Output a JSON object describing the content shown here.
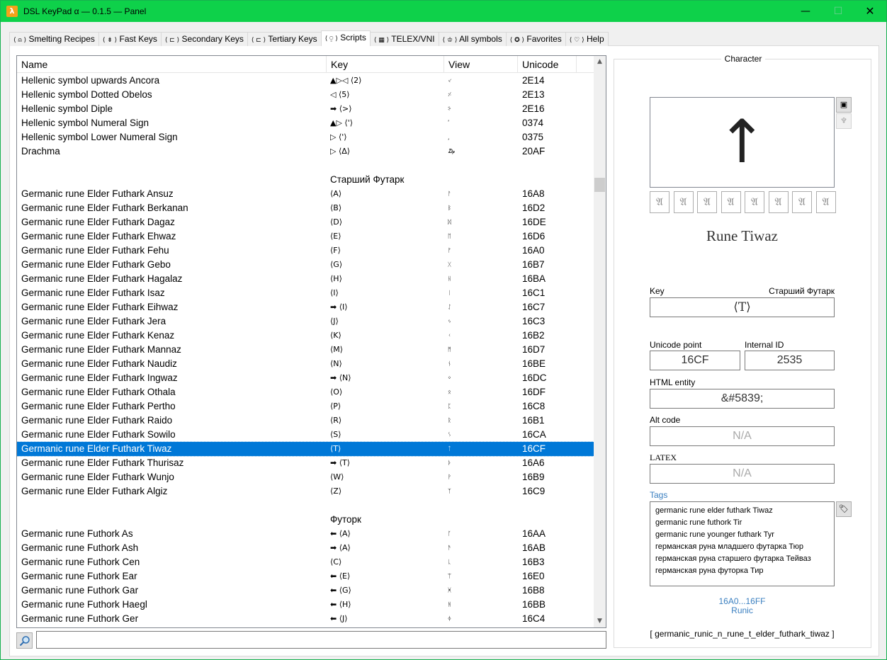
{
  "window": {
    "app_icon": "λ",
    "title": "DSL KeyPad α — 0.1.5 — Panel",
    "min_glyph": "—",
    "max_glyph": "☐",
    "close_glyph": "✕"
  },
  "tabs": [
    {
      "icon": "⟨ ⍝ ⟩",
      "label": "Smelting Recipes"
    },
    {
      "icon": "⟨ ⇟ ⟩",
      "label": "Fast Keys"
    },
    {
      "icon": "⟨ ⊏ ⟩",
      "label": "Secondary Keys"
    },
    {
      "icon": "⟨ ⊏ ⟩",
      "label": "Tertiary Keys"
    },
    {
      "icon": "⟨ ⍜ ⟩",
      "label": "Scripts"
    },
    {
      "icon": "⟨ ▦ ⟩",
      "label": "TELEX/VNI"
    },
    {
      "icon": "⟨ ♔ ⟩",
      "label": "All symbols"
    },
    {
      "icon": "⟨ ✪ ⟩",
      "label": "Favorites"
    },
    {
      "icon": "⟨ ♡ ⟩",
      "label": "Help"
    }
  ],
  "active_tab": 4,
  "list": {
    "columns": {
      "name": "Name",
      "key": "Key",
      "view": "View",
      "unicode": "Unicode"
    },
    "rows": [
      {
        "name": "Hellenic symbol upwards Ancora",
        "key": "▲▷◁ ⟨2⟩",
        "view": "⸔",
        "unicode": "2E14"
      },
      {
        "name": "Hellenic symbol Dotted Obelos",
        "key": "◁ ⟨5⟩",
        "view": "⸓",
        "unicode": "2E13"
      },
      {
        "name": "Hellenic symbol Diple",
        "key": "➡ ⟨>⟩",
        "view": "⸖",
        "unicode": "2E16"
      },
      {
        "name": "Hellenic symbol Numeral Sign",
        "key": "▲▷ ⟨'⟩",
        "view": "ʹ",
        "unicode": "0374"
      },
      {
        "name": "Hellenic symbol Lower Numeral Sign",
        "key": "▷ ⟨'⟩",
        "view": "͵",
        "unicode": "0375"
      },
      {
        "name": "Drachma",
        "key": "▷ ⟨Δ⟩",
        "view": "₯",
        "unicode": "20AF"
      },
      {
        "name": "",
        "key": "",
        "view": "",
        "unicode": "",
        "blank": true
      },
      {
        "name": "",
        "key": "Старший Футарк",
        "view": "",
        "unicode": "",
        "group": true
      },
      {
        "name": "Germanic rune Elder Futhark Ansuz",
        "key": "⟨A⟩",
        "view": "ᚨ",
        "unicode": "16A8"
      },
      {
        "name": "Germanic rune Elder Futhark Berkanan",
        "key": "⟨B⟩",
        "view": "ᛒ",
        "unicode": "16D2"
      },
      {
        "name": "Germanic rune Elder Futhark Dagaz",
        "key": "⟨D⟩",
        "view": "ᛞ",
        "unicode": "16DE"
      },
      {
        "name": "Germanic rune Elder Futhark Ehwaz",
        "key": "⟨E⟩",
        "view": "ᛖ",
        "unicode": "16D6"
      },
      {
        "name": "Germanic rune Elder Futhark Fehu",
        "key": "⟨F⟩",
        "view": "ᚠ",
        "unicode": "16A0"
      },
      {
        "name": "Germanic rune Elder Futhark Gebo",
        "key": "⟨G⟩",
        "view": "ᚷ",
        "unicode": "16B7"
      },
      {
        "name": "Germanic rune Elder Futhark Hagalaz",
        "key": "⟨H⟩",
        "view": "ᚺ",
        "unicode": "16BA"
      },
      {
        "name": "Germanic rune Elder Futhark Isaz",
        "key": "⟨I⟩",
        "view": "ᛁ",
        "unicode": "16C1"
      },
      {
        "name": "Germanic rune Elder Futhark Eihwaz",
        "key": "➡ ⟨I⟩",
        "view": "ᛇ",
        "unicode": "16C7"
      },
      {
        "name": "Germanic rune Elder Futhark Jera",
        "key": "⟨J⟩",
        "view": "ᛃ",
        "unicode": "16C3"
      },
      {
        "name": "Germanic rune Elder Futhark Kenaz",
        "key": "⟨K⟩",
        "view": "ᚲ",
        "unicode": "16B2"
      },
      {
        "name": "Germanic rune Elder Futhark Mannaz",
        "key": "⟨M⟩",
        "view": "ᛗ",
        "unicode": "16D7"
      },
      {
        "name": "Germanic rune Elder Futhark Naudiz",
        "key": "⟨N⟩",
        "view": "ᚾ",
        "unicode": "16BE"
      },
      {
        "name": "Germanic rune Elder Futhark Ingwaz",
        "key": "➡ ⟨N⟩",
        "view": "ᛜ",
        "unicode": "16DC"
      },
      {
        "name": "Germanic rune Elder Futhark Othala",
        "key": "⟨O⟩",
        "view": "ᛟ",
        "unicode": "16DF"
      },
      {
        "name": "Germanic rune Elder Futhark Pertho",
        "key": "⟨P⟩",
        "view": "ᛈ",
        "unicode": "16C8"
      },
      {
        "name": "Germanic rune Elder Futhark Raido",
        "key": "⟨R⟩",
        "view": "ᚱ",
        "unicode": "16B1"
      },
      {
        "name": "Germanic rune Elder Futhark Sowilo",
        "key": "⟨S⟩",
        "view": "ᛊ",
        "unicode": "16CA"
      },
      {
        "name": "Germanic rune Elder Futhark Tiwaz",
        "key": "⟨T⟩",
        "view": "ᛏ",
        "unicode": "16CF",
        "selected": true
      },
      {
        "name": "Germanic rune Elder Futhark Thurisaz",
        "key": "➡ ⟨T⟩",
        "view": "ᚦ",
        "unicode": "16A6"
      },
      {
        "name": "Germanic rune Elder Futhark Wunjo",
        "key": "⟨W⟩",
        "view": "ᚹ",
        "unicode": "16B9"
      },
      {
        "name": "Germanic rune Elder Futhark Algiz",
        "key": "⟨Z⟩",
        "view": "ᛉ",
        "unicode": "16C9"
      },
      {
        "name": "",
        "key": "",
        "view": "",
        "unicode": "",
        "blank": true
      },
      {
        "name": "",
        "key": "Футорк",
        "view": "",
        "unicode": "",
        "group": true
      },
      {
        "name": "Germanic rune Futhork As",
        "key": "⬅ ⟨A⟩",
        "view": "ᚪ",
        "unicode": "16AA"
      },
      {
        "name": "Germanic rune Futhork Ash",
        "key": "➡ ⟨A⟩",
        "view": "ᚫ",
        "unicode": "16AB"
      },
      {
        "name": "Germanic rune Futhork Cen",
        "key": "⟨C⟩",
        "view": "ᚳ",
        "unicode": "16B3"
      },
      {
        "name": "Germanic rune Futhork Ear",
        "key": "⬅ ⟨E⟩",
        "view": "ᛠ",
        "unicode": "16E0"
      },
      {
        "name": "Germanic rune Futhork Gar",
        "key": "⬅ ⟨G⟩",
        "view": "ᚸ",
        "unicode": "16B8"
      },
      {
        "name": "Germanic rune Futhork Haegl",
        "key": "⬅ ⟨H⟩",
        "view": "ᚻ",
        "unicode": "16BB"
      },
      {
        "name": "Germanic rune Futhork Ger",
        "key": "⬅ ⟨J⟩",
        "view": "ᛄ",
        "unicode": "16C4"
      }
    ],
    "scroll_up": "▲",
    "scroll_down": "▼"
  },
  "search": {
    "value": "",
    "placeholder": ""
  },
  "character": {
    "group_title": "Character",
    "preview_glyph": "↑",
    "variant_glyph": "𝔄",
    "variant_count": 8,
    "side_btn_1": "▣",
    "side_btn_2": "♆",
    "name": "Rune Tiwaz",
    "key_label": "Key",
    "key_group": "Старший Футарк",
    "key_value": "⟨T⟩",
    "unicode_label": "Unicode point",
    "unicode_value": "16CF",
    "internal_id_label": "Internal ID",
    "internal_id_value": "2535",
    "html_label": "HTML entity",
    "html_value": "&#5839;",
    "altcode_label": "Alt code",
    "altcode_value": "N/A",
    "latex_label": "LATEX",
    "latex_value": "N/A",
    "tags_label": "Tags",
    "tag_btn": "🏷",
    "tags": [
      "germanic rune elder futhark Tiwaz",
      "germanic rune futhork Tir",
      "germanic rune younger futhark Tyr",
      "германская руна младшего футарка Тюр",
      "германская руна старшего футарка Тейваз",
      "германская руна футорка Тир"
    ],
    "range": "16A0...16FF",
    "block": "Runic",
    "identifier": "[   germanic_runic_n_rune_t_elder_futhark_tiwaz   ]"
  },
  "colors": {
    "titlebar": "#0ed14a",
    "selection": "#0078d7",
    "link": "#3a7fc0"
  }
}
